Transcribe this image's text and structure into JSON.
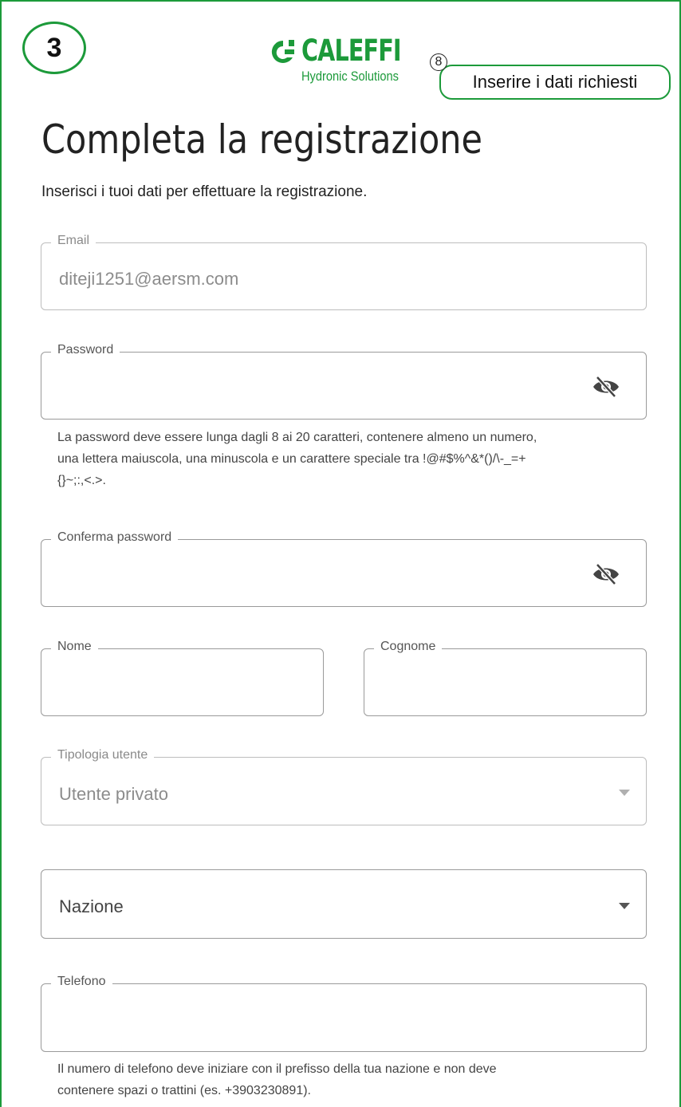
{
  "step": {
    "number": "3"
  },
  "logo": {
    "brand": "CALEFFI",
    "tagline": "Hydronic Solutions"
  },
  "callout": {
    "number": "8",
    "text": "Inserire i dati richiesti"
  },
  "page": {
    "title": "Completa la registrazione",
    "subtitle": "Inserisci i tuoi dati per effettuare la registrazione."
  },
  "form": {
    "email": {
      "label": "Email",
      "value": "diteji1251@aersm.com"
    },
    "password": {
      "label": "Password",
      "hint_line1": "La password deve essere lunga dagli 8 ai 20 caratteri, contenere almeno un numero,",
      "hint_line2": "una lettera maiuscola, una minuscola e un carattere speciale tra !@#$%^&*()/\\-_=+",
      "hint_line3": "{}~;:,<.>."
    },
    "confirm_password": {
      "label": "Conferma password"
    },
    "first_name": {
      "label": "Nome"
    },
    "last_name": {
      "label": "Cognome"
    },
    "user_type": {
      "label": "Tipologia utente",
      "value": "Utente privato"
    },
    "country": {
      "placeholder": "Nazione"
    },
    "phone": {
      "label": "Telefono",
      "hint_line1": "Il numero di telefono deve iniziare con il prefisso della tua nazione e non deve",
      "hint_line2": "contenere spazi o trattini (es. +3903230891)."
    }
  },
  "colors": {
    "brand_green": "#1c9a3a",
    "border": "#9a9a9a",
    "muted_text": "#8c8c8c"
  },
  "icons": {
    "password_toggle": "eye-off-icon",
    "dropdown": "caret-down-icon"
  }
}
